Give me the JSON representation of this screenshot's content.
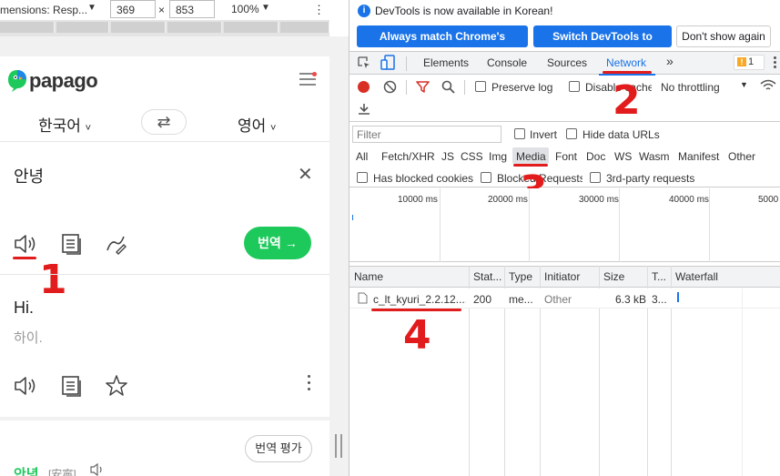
{
  "device_toolbar": {
    "dimensions_label": "mensions: Resp...",
    "chevron": "▼",
    "width": "369",
    "times": "×",
    "height": "853",
    "zoom": "100%",
    "zoom_chevron": "▼",
    "more": "⋮"
  },
  "papago": {
    "logo_text": "papago",
    "source_language": "한국어",
    "target_language": "영어",
    "swap_symbol": "⇄",
    "input_text": "안녕",
    "clear_symbol": "✕",
    "translate_button": "번역 →",
    "result_text": "Hi.",
    "result_pronunciation": "하이.",
    "evaluate_button": "번역 평가",
    "dictionary_word": "안녕",
    "dictionary_hanja": "[安寧]"
  },
  "annotations": {
    "step1": "1",
    "step2": "2",
    "step3": "3",
    "step4": "4",
    "color": "#e21c1c"
  },
  "devtools": {
    "info_message": "DevTools is now available in Korean!",
    "info_icon": "i",
    "btn_match_language": "Always match Chrome's language",
    "btn_switch_korean": "Switch DevTools to Korean",
    "btn_dont_show": "Don't show again",
    "tabs": [
      "Elements",
      "Console",
      "Sources",
      "Network"
    ],
    "more_tabs": "»",
    "warning_count": "1",
    "active_tab": "Network",
    "toolbar": {
      "preserve_log": "Preserve log",
      "disable_cache": "Disable cache",
      "throttling": "No throttling"
    },
    "filter_placeholder": "Filter",
    "invert": "Invert",
    "hide_data_urls": "Hide data URLs",
    "types": [
      "All",
      "Fetch/XHR",
      "JS",
      "CSS",
      "Img",
      "Media",
      "Font",
      "Doc",
      "WS",
      "Wasm",
      "Manifest",
      "Other"
    ],
    "active_type": "Media",
    "has_blocked_cookies": "Has blocked cookies",
    "blocked_requests": "Blocked Requests",
    "third_party": "3rd-party requests",
    "timeline_ticks": [
      "10000 ms",
      "20000 ms",
      "30000 ms",
      "40000 ms",
      "5000"
    ],
    "columns": [
      "Name",
      "Stat...",
      "Type",
      "Initiator",
      "Size",
      "T...",
      "Waterfall"
    ],
    "rows": [
      {
        "name": "c_lt_kyuri_2.2.12....",
        "status": "200",
        "type": "me...",
        "initiator": "Other",
        "size": "6.3 kB",
        "time": "3..."
      }
    ]
  },
  "colors": {
    "papago_green": "#1ec95b",
    "devtools_blue": "#1a73e8",
    "record_red": "#d93025"
  }
}
